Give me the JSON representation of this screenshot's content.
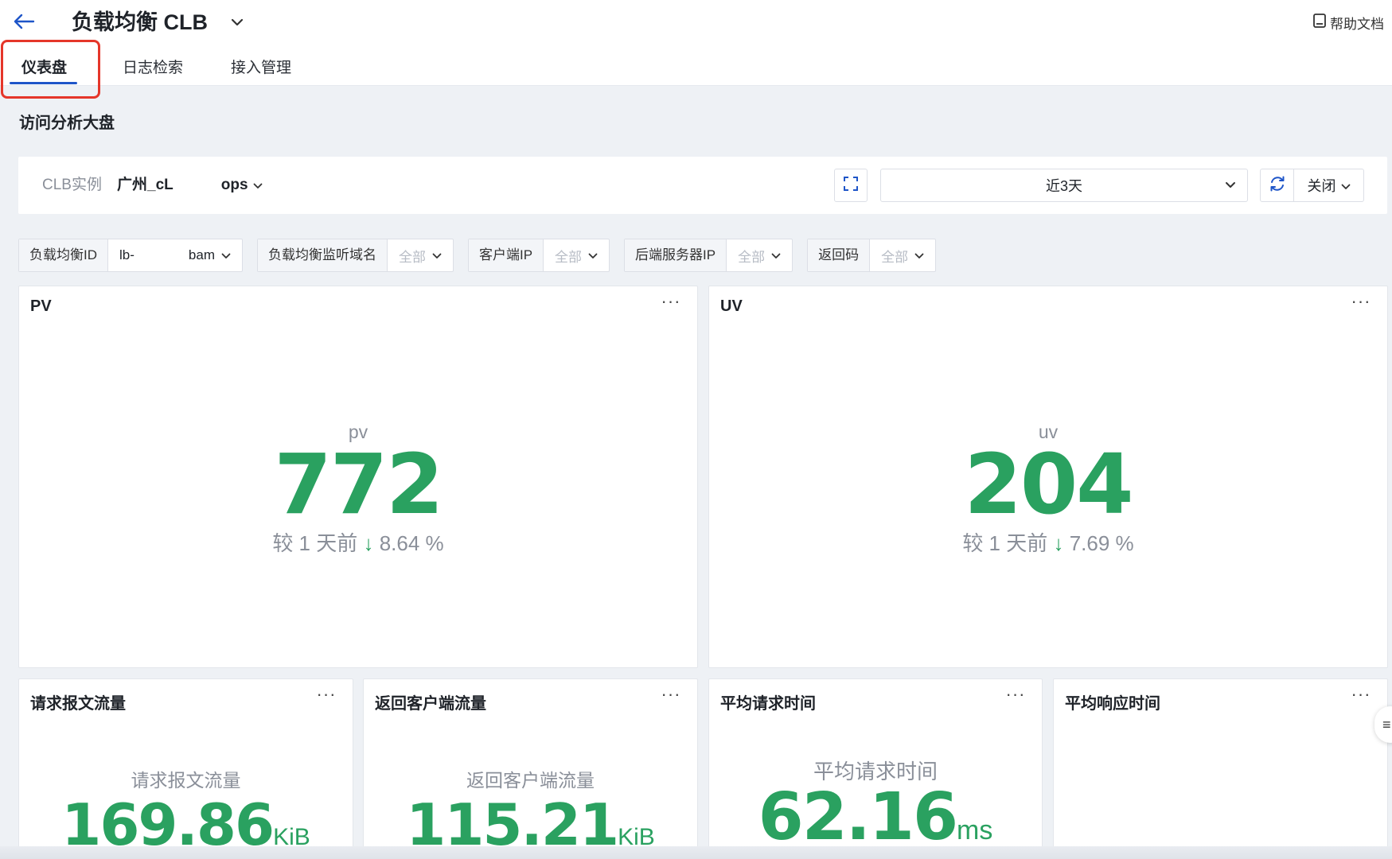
{
  "header": {
    "title": "负载均衡 CLB",
    "help_label": "帮助文档"
  },
  "tabs": [
    {
      "label": "仪表盘",
      "active": true
    },
    {
      "label": "日志检索",
      "active": false
    },
    {
      "label": "接入管理",
      "active": false
    }
  ],
  "section_title": "访问分析大盘",
  "controls": {
    "clb_label": "CLB实例",
    "clb_value_start": "广州_cL",
    "clb_value_end": "ops",
    "time_range": "近3天",
    "refresh_label": "关闭"
  },
  "filters": [
    {
      "label": "负载均衡ID",
      "value_start": "lb-",
      "value_end": "bam",
      "placeholder": false
    },
    {
      "label": "负载均衡监听域名",
      "value": "全部",
      "placeholder": true
    },
    {
      "label": "客户端IP",
      "value": "全部",
      "placeholder": true
    },
    {
      "label": "后端服务器IP",
      "value": "全部",
      "placeholder": true
    },
    {
      "label": "返回码",
      "value": "全部",
      "placeholder": true
    }
  ],
  "cards": {
    "pv": {
      "title": "PV",
      "label": "pv",
      "value": "772",
      "compare_prefix": "较 1 天前",
      "arrow": "↓",
      "compare_value": "8.64 %"
    },
    "uv": {
      "title": "UV",
      "label": "uv",
      "value": "204",
      "compare_prefix": "较 1 天前",
      "arrow": "↓",
      "compare_value": "7.69 %"
    },
    "req_traffic": {
      "title": "请求报文流量",
      "label": "请求报文流量",
      "value": "169.86",
      "unit": "KiB"
    },
    "resp_traffic": {
      "title": "返回客户端流量",
      "label": "返回客户端流量",
      "value": "115.21",
      "unit": "KiB"
    },
    "avg_req_time": {
      "title": "平均请求时间",
      "label": "平均请求时间",
      "value": "62.16",
      "unit": "ms"
    },
    "avg_resp_time": {
      "title": "平均响应时间"
    }
  },
  "more_label": "···",
  "colors": {
    "accent": "#1e55c8",
    "metric_green": "#2aa160",
    "highlight_red": "#e5362a"
  }
}
